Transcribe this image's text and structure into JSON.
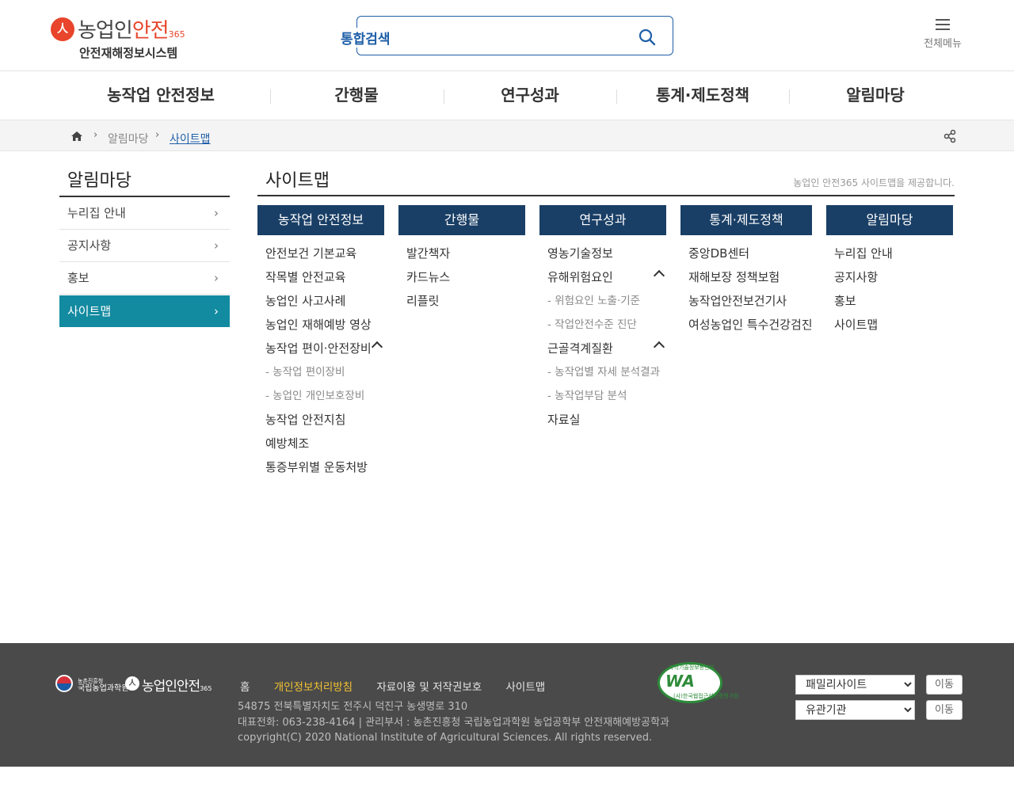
{
  "header": {
    "logo_mark": "人",
    "logo_title_a": "농업인",
    "logo_title_b": "안전",
    "logo_title_num": "365",
    "logo_subtitle": "안전재해정보시스템",
    "search_label": "통합검색",
    "search_icon": "search-icon",
    "allmenu_label": "전체메뉴",
    "allmenu_icon": "hamburger-icon"
  },
  "gnb": {
    "items": [
      "농작업 안전정보",
      "간행물",
      "연구성과",
      "통계·제도정책",
      "알림마당"
    ]
  },
  "breadcrumb": {
    "home_icon": "home-icon",
    "items": [
      "알림마당",
      "사이트맵"
    ],
    "share_icon": "share-icon"
  },
  "lnb": {
    "title": "알림마당",
    "items": [
      "누리집 안내",
      "공지사항",
      "홍보",
      "사이트맵"
    ],
    "active_index": 3,
    "active_color": "#128aa0"
  },
  "content": {
    "title": "사이트맵",
    "description": "농업인 안전365 사이트맵을 제공합니다.",
    "header_color": "#1a3f66",
    "columns": [
      {
        "title": "농작업 안전정보",
        "items": [
          {
            "label": "안전보건 기본교육"
          },
          {
            "label": "작목별 안전교육"
          },
          {
            "label": "농업인 사고사례"
          },
          {
            "label": "농업인 재해예방 영상"
          },
          {
            "label": "농작업 편이·안전장비",
            "expanded": true,
            "sub": [
              "- 농작업 편이장비",
              "- 농업인 개인보호장비"
            ]
          },
          {
            "label": "농작업 안전지침"
          },
          {
            "label": "예방체조"
          },
          {
            "label": "통증부위별 운동처방"
          }
        ]
      },
      {
        "title": "간행물",
        "items": [
          {
            "label": "발간책자"
          },
          {
            "label": "카드뉴스"
          },
          {
            "label": "리플릿"
          }
        ]
      },
      {
        "title": "연구성과",
        "items": [
          {
            "label": "영농기술정보"
          },
          {
            "label": "유해위험요인",
            "expanded": true,
            "sub": [
              "- 위험요인 노출·기준",
              "- 작업안전수준 진단"
            ]
          },
          {
            "label": "근골격계질환",
            "expanded": true,
            "sub": [
              "- 농작업별 자세 분석결과",
              "- 농작업부담 분석"
            ]
          },
          {
            "label": "자료실"
          }
        ]
      },
      {
        "title": "통계·제도정책",
        "items": [
          {
            "label": "중앙DB센터"
          },
          {
            "label": "재해보장 정책보험"
          },
          {
            "label": "농작업안전보건기사"
          },
          {
            "label": "여성농업인 특수건강검진"
          }
        ]
      },
      {
        "title": "알림마당",
        "items": [
          {
            "label": "누리집 안내"
          },
          {
            "label": "공지사항"
          },
          {
            "label": "홍보"
          },
          {
            "label": "사이트맵"
          }
        ]
      }
    ]
  },
  "footer": {
    "logo1_line1": "농촌진흥청",
    "logo1_line2": "국립농업과학원",
    "logo2_mark": "人",
    "logo2_text": "농업인안전",
    "logo2_num": "365",
    "links": [
      {
        "label": "홈",
        "highlight": false
      },
      {
        "label": "개인정보처리방침",
        "highlight": true
      },
      {
        "label": "자료이용 및 저작권보호",
        "highlight": false
      },
      {
        "label": "사이트맵",
        "highlight": false
      }
    ],
    "highlight_color": "#f2c230",
    "address": "54875 전북특별자치도 전주시 덕진구 농생명로 310",
    "contact": "대표전화: 063-238-4164 | 관리부서 : 농촌진흥청 국립농업과학원 농업공학부 안전재해예방공학과",
    "copyright": "copyright(C) 2020 National Institute of Agricultural Sciences. All rights reserved.",
    "wa_mark": {
      "text": "WA",
      "top": "과학기술정보통신부",
      "bottom": "(사)한국웹접근성인증평가원",
      "color": "#2e8b3a"
    },
    "family_select": "패밀리사이트",
    "related_select": "유관기관",
    "go_label": "이동"
  }
}
